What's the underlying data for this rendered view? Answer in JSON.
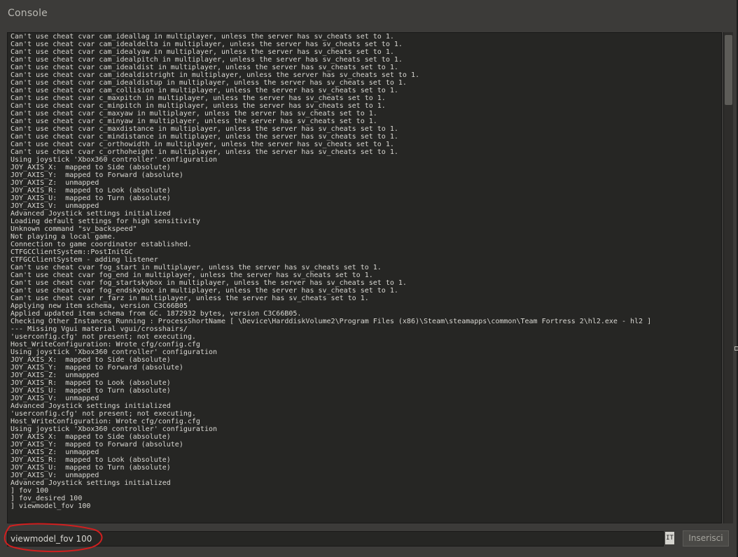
{
  "window": {
    "title": "Console"
  },
  "console": {
    "lines": [
      "Can't use cheat cvar cam_ideallag in multiplayer, unless the server has sv_cheats set to 1.",
      "Can't use cheat cvar cam_idealdelta in multiplayer, unless the server has sv_cheats set to 1.",
      "Can't use cheat cvar cam_idealyaw in multiplayer, unless the server has sv_cheats set to 1.",
      "Can't use cheat cvar cam_idealpitch in multiplayer, unless the server has sv_cheats set to 1.",
      "Can't use cheat cvar cam_idealdist in multiplayer, unless the server has sv_cheats set to 1.",
      "Can't use cheat cvar cam_idealdistright in multiplayer, unless the server has sv_cheats set to 1.",
      "Can't use cheat cvar cam_idealdistup in multiplayer, unless the server has sv_cheats set to 1.",
      "Can't use cheat cvar cam_collision in multiplayer, unless the server has sv_cheats set to 1.",
      "Can't use cheat cvar c_maxpitch in multiplayer, unless the server has sv_cheats set to 1.",
      "Can't use cheat cvar c_minpitch in multiplayer, unless the server has sv_cheats set to 1.",
      "Can't use cheat cvar c_maxyaw in multiplayer, unless the server has sv_cheats set to 1.",
      "Can't use cheat cvar c_minyaw in multiplayer, unless the server has sv_cheats set to 1.",
      "Can't use cheat cvar c_maxdistance in multiplayer, unless the server has sv_cheats set to 1.",
      "Can't use cheat cvar c_mindistance in multiplayer, unless the server has sv_cheats set to 1.",
      "Can't use cheat cvar c_orthowidth in multiplayer, unless the server has sv_cheats set to 1.",
      "Can't use cheat cvar c_orthoheight in multiplayer, unless the server has sv_cheats set to 1.",
      "Using joystick 'Xbox360 controller' configuration",
      "JOY_AXIS_X:  mapped to Side (absolute)",
      "JOY_AXIS_Y:  mapped to Forward (absolute)",
      "JOY_AXIS_Z:  unmapped",
      "JOY_AXIS_R:  mapped to Look (absolute)",
      "JOY_AXIS_U:  mapped to Turn (absolute)",
      "JOY_AXIS_V:  unmapped",
      "Advanced Joystick settings initialized",
      "Loading default settings for high sensitivity",
      "Unknown command \"sv_backspeed\"",
      "Not playing a local game.",
      "Connection to game coordinator established.",
      "CTFGCClientSystem::PostInitGC",
      "CTFGCClientSystem - adding listener",
      "Can't use cheat cvar fog_start in multiplayer, unless the server has sv_cheats set to 1.",
      "Can't use cheat cvar fog_end in multiplayer, unless the server has sv_cheats set to 1.",
      "Can't use cheat cvar fog_startskybox in multiplayer, unless the server has sv_cheats set to 1.",
      "Can't use cheat cvar fog_endskybox in multiplayer, unless the server has sv_cheats set to 1.",
      "Can't use cheat cvar r_farz in multiplayer, unless the server has sv_cheats set to 1.",
      "Applying new item schema, version C3C66B05",
      "Applied updated item schema from GC. 1872932 bytes, version C3C66B05.",
      "Checking Other Instances Running : ProcessShortName [ \\Device\\HarddiskVolume2\\Program Files (x86)\\Steam\\steamapps\\common\\Team Fortress 2\\hl2.exe - hl2 ]",
      "--- Missing Vgui material vgui/crosshairs/",
      "'userconfig.cfg' not present; not executing.",
      "Host_WriteConfiguration: Wrote cfg/config.cfg",
      "Using joystick 'Xbox360 controller' configuration",
      "JOY_AXIS_X:  mapped to Side (absolute)",
      "JOY_AXIS_Y:  mapped to Forward (absolute)",
      "JOY_AXIS_Z:  unmapped",
      "JOY_AXIS_R:  mapped to Look (absolute)",
      "JOY_AXIS_U:  mapped to Turn (absolute)",
      "JOY_AXIS_V:  unmapped",
      "Advanced Joystick settings initialized",
      "'userconfig.cfg' not present; not executing.",
      "Host_WriteConfiguration: Wrote cfg/config.cfg",
      "Using joystick 'Xbox360 controller' configuration",
      "JOY_AXIS_X:  mapped to Side (absolute)",
      "JOY_AXIS_Y:  mapped to Forward (absolute)",
      "JOY_AXIS_Z:  unmapped",
      "JOY_AXIS_R:  mapped to Look (absolute)",
      "JOY_AXIS_U:  mapped to Turn (absolute)",
      "JOY_AXIS_V:  unmapped",
      "Advanced Joystick settings initialized",
      "] fov 100",
      "] fov_desired 100",
      "] viewmodel_fov 100"
    ]
  },
  "command": {
    "value": "viewmodel_fov 100",
    "language_indicator": "IT",
    "submit_label": "Inserisci"
  },
  "colors": {
    "window_bg": "#3c3b39",
    "console_bg": "#262624",
    "text": "#d9d8d3",
    "annotation": "#d11f1f"
  },
  "icons": {
    "scrollbar": "scrollbar-thumb",
    "resize": "resize-handle-icon"
  }
}
